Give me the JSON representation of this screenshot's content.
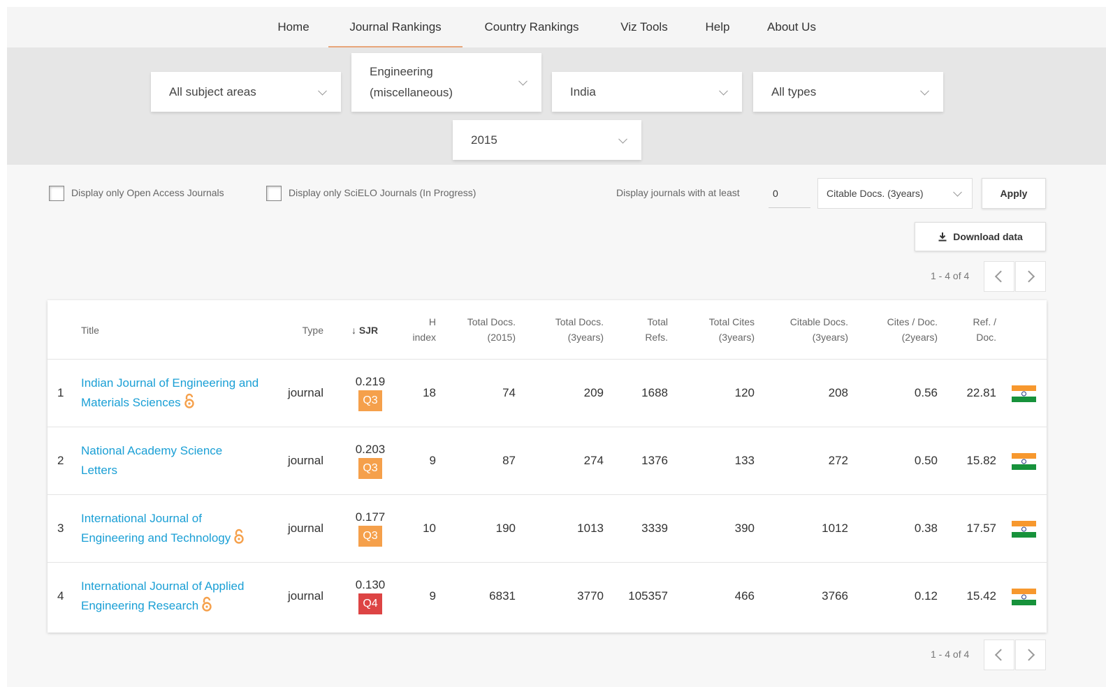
{
  "nav": {
    "items": [
      {
        "label": "Home",
        "active": false
      },
      {
        "label": "Journal Rankings",
        "active": true
      },
      {
        "label": "Country Rankings",
        "active": false
      },
      {
        "label": "Viz Tools",
        "active": false
      },
      {
        "label": "Help",
        "active": false
      },
      {
        "label": "About Us",
        "active": false
      }
    ]
  },
  "filters": {
    "subject_area": "All subject areas",
    "subject_category": "Engineering (miscellaneous)",
    "region": "India",
    "type": "All types",
    "year": "2015"
  },
  "controls": {
    "open_access_label": "Display only Open Access Journals",
    "scielo_label": "Display only SciELO Journals (In Progress)",
    "min_label": "Display journals with at least",
    "min_value": "0",
    "min_metric": "Citable Docs. (3years)",
    "apply_label": "Apply",
    "download_label": "Download data",
    "pager_text": "1 - 4 of 4"
  },
  "colors": {
    "link": "#1a9fd5",
    "q3": "#f5a04b",
    "q4": "#dd4444",
    "active_tab_underline": "#e8a67a"
  },
  "table": {
    "headers": {
      "title": "Title",
      "type": "Type",
      "sjr": "SJR",
      "h_index_1": "H",
      "h_index_2": "index",
      "total_docs_1": "Total Docs.",
      "total_docs_2": "(2015)",
      "total_docs3_1": "Total Docs.",
      "total_docs3_2": "(3years)",
      "total_refs_1": "Total",
      "total_refs_2": "Refs.",
      "total_cites_1": "Total Cites",
      "total_cites_2": "(3years)",
      "citable_1": "Citable Docs.",
      "citable_2": "(3years)",
      "cites_doc_1": "Cites / Doc.",
      "cites_doc_2": "(2years)",
      "ref_doc_1": "Ref. /",
      "ref_doc_2": "Doc."
    },
    "rows": [
      {
        "rank": "1",
        "title": "Indian Journal of Engineering and Materials Sciences",
        "open_access": true,
        "type": "journal",
        "sjr": "0.219",
        "quartile": "Q3",
        "h_index": "18",
        "total_docs": "74",
        "total_docs_3y": "209",
        "total_refs": "1688",
        "total_cites_3y": "120",
        "citable_docs_3y": "208",
        "cites_per_doc_2y": "0.56",
        "ref_per_doc": "22.81",
        "flag": "india-flag-icon"
      },
      {
        "rank": "2",
        "title": "National Academy Science Letters",
        "open_access": false,
        "type": "journal",
        "sjr": "0.203",
        "quartile": "Q3",
        "h_index": "9",
        "total_docs": "87",
        "total_docs_3y": "274",
        "total_refs": "1376",
        "total_cites_3y": "133",
        "citable_docs_3y": "272",
        "cites_per_doc_2y": "0.50",
        "ref_per_doc": "15.82",
        "flag": "india-flag-icon"
      },
      {
        "rank": "3",
        "title": "International Journal of Engineering and Technology",
        "open_access": true,
        "type": "journal",
        "sjr": "0.177",
        "quartile": "Q3",
        "h_index": "10",
        "total_docs": "190",
        "total_docs_3y": "1013",
        "total_refs": "3339",
        "total_cites_3y": "390",
        "citable_docs_3y": "1012",
        "cites_per_doc_2y": "0.38",
        "ref_per_doc": "17.57",
        "flag": "india-flag-icon"
      },
      {
        "rank": "4",
        "title": "International Journal of Applied Engineering Research",
        "open_access": true,
        "type": "journal",
        "sjr": "0.130",
        "quartile": "Q4",
        "h_index": "9",
        "total_docs": "6831",
        "total_docs_3y": "3770",
        "total_refs": "105357",
        "total_cites_3y": "466",
        "citable_docs_3y": "3766",
        "cites_per_doc_2y": "0.12",
        "ref_per_doc": "15.42",
        "flag": "india-flag-icon"
      }
    ]
  }
}
